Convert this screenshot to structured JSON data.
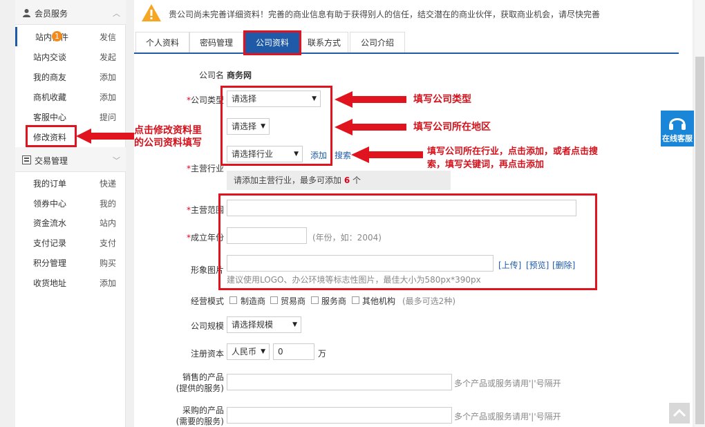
{
  "sidebar": {
    "group1_title": "会员服务",
    "badge": "1",
    "items": [
      {
        "label": "站内信件",
        "action": "发信"
      },
      {
        "label": "站内交谈",
        "action": "发起"
      },
      {
        "label": "我的商友",
        "action": "添加"
      },
      {
        "label": "商机收藏",
        "action": "添加"
      },
      {
        "label": "客服中心",
        "action": "提问"
      },
      {
        "label": "修改资料",
        "action": ""
      }
    ],
    "group2_title": "交易管理",
    "items2": [
      {
        "label": "我的订单",
        "action": "快递"
      },
      {
        "label": "领券中心",
        "action": "我的"
      },
      {
        "label": "资金流水",
        "action": "站内"
      },
      {
        "label": "支付记录",
        "action": "支付"
      },
      {
        "label": "积分管理",
        "action": "购买"
      },
      {
        "label": "收货地址",
        "action": "添加"
      }
    ]
  },
  "notice": "贵公司尚未完善详细资料！完善的商业信息有助于获得别人的信任，结交潜在的商业伙伴，获取商业机会，请尽快完善",
  "tabs": [
    "个人资料",
    "密码管理",
    "公司资料",
    "联系方式",
    "公司介绍"
  ],
  "form": {
    "company_name_label": "公司名",
    "company_name_value": "商务网",
    "company_type_label": "公司类型",
    "company_type_value": "请选择",
    "region_value": "请选择",
    "industry_value": "请选择行业",
    "add_link": "添加",
    "search_link": "搜索",
    "main_industry_label": "主营行业",
    "main_industry_hint_prefix": "请添加主营行业，最多可添加",
    "main_industry_max": "6",
    "main_industry_hint_suffix": "个",
    "scope_label": "主营范围",
    "year_label": "成立年份",
    "year_hint": "(年份，如：2004)",
    "image_label": "形象图片",
    "upload": "[上传]",
    "preview": "[预览]",
    "delete": "[删除]",
    "image_hint": "建议使用LOGO、办公环境等标志性图片，最佳大小为580px*390px",
    "mode_label": "经营模式",
    "modes": [
      "制造商",
      "贸易商",
      "服务商",
      "其他机构"
    ],
    "mode_hint": "(最多可选2种)",
    "scale_label": "公司规模",
    "scale_value": "请选择规模",
    "capital_label": "注册资本",
    "currency": "人民币",
    "capital_value": "0",
    "capital_unit": "万",
    "sell_label_1": "销售的产品",
    "sell_label_2": "(提供的服务)",
    "sell_hint": "多个产品或服务请用'|'号隔开",
    "buy_label_1": "采购的产品",
    "buy_label_2": "(需要的服务)",
    "buy_hint": "多个产品或服务请用'|'号隔开"
  },
  "annotations": {
    "edit_profile_1": "点击修改资料里",
    "edit_profile_2": "的公司资料填写",
    "company_type": "填写公司类型",
    "region": "填写公司所在地区",
    "industry_1": "填写公司所在行业，点击添加，或者点击搜",
    "industry_2": "索，填写关键词，再点击添加"
  },
  "online_service": "在线客服",
  "colors": {
    "accent": "#1e5aa8",
    "annotation": "#e0141e",
    "badge": "#f28a1c"
  }
}
